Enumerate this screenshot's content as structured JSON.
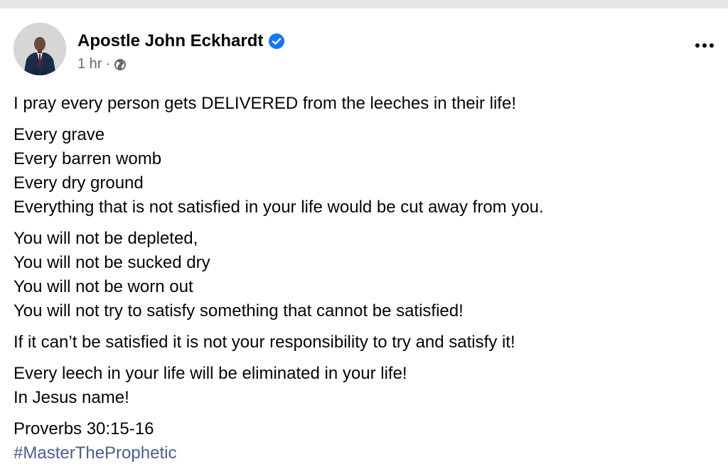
{
  "post": {
    "author": "Apostle John Eckhardt",
    "verified": true,
    "timestamp": "1 hr",
    "separator": "·",
    "privacy_icon": "globe-icon",
    "more_icon": "more-options-icon",
    "paragraphs": [
      [
        "I pray every person gets DELIVERED from the leeches in their life!"
      ],
      [
        "Every grave",
        "Every barren womb",
        "Every dry ground",
        "Everything that is not satisfied in your life would be cut away from you."
      ],
      [
        "You will not be depleted,",
        "You will not be sucked dry",
        "You will not be worn out",
        "You will not try to satisfy something that cannot be satisfied!"
      ],
      [
        "If it can’t be satisfied it is not your responsibility to try and satisfy it!"
      ],
      [
        "Every leech in your life will be eliminated in your life!",
        "In Jesus name!"
      ],
      [
        "Proverbs 30:15-16"
      ]
    ],
    "hashtag": "#MasterTheProphetic"
  },
  "colors": {
    "verified_badge": "#1877f2",
    "hashtag": "#4a5f8e",
    "meta_text": "#65676b",
    "top_strip": "#e4e6e9"
  }
}
